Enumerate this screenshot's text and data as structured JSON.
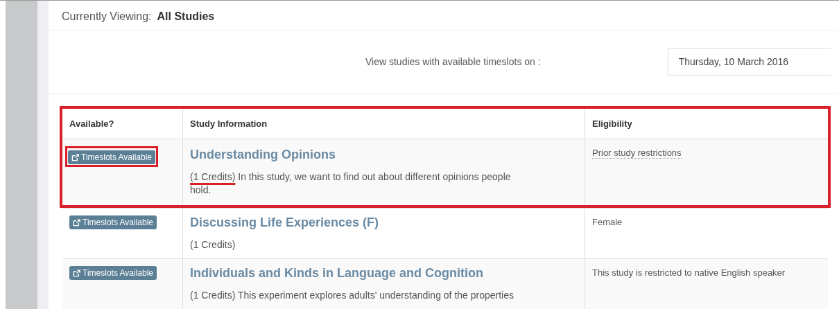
{
  "viewing": {
    "label": "Currently Viewing:",
    "value": "All Studies"
  },
  "date_filter": {
    "label": "View studies with available timeslots on :",
    "value": "Thursday, 10 March 2016"
  },
  "table": {
    "columns": [
      "Available?",
      "Study Information",
      "Eligibility"
    ],
    "rows": [
      {
        "button": "Timeslots Available",
        "title": "Understanding Opinions",
        "credits": "(1 Credits)",
        "description": "In this study, we want to find out about different opinions people hold.",
        "eligibility": "Prior study restrictions",
        "eligibility_hint": true,
        "framed": true,
        "button_boxed": true,
        "credits_underlined": true
      },
      {
        "button": "Timeslots Available",
        "title": "Discussing Life Experiences (F)",
        "credits": "(1 Credits)",
        "eligibility": "Female",
        "eligibility_hint": false,
        "framed": false,
        "button_boxed": false,
        "credits_underlined": false
      },
      {
        "button": "Timeslots Available",
        "title": "Individuals and Kinds in Language and Cognition",
        "credits": "(1 Credits)",
        "description": "This experiment explores adults' understanding of the properties",
        "eligibility": "This study is restricted to native English speaker",
        "eligibility_hint": false,
        "framed": false,
        "button_boxed": false,
        "credits_underlined": false
      }
    ]
  }
}
